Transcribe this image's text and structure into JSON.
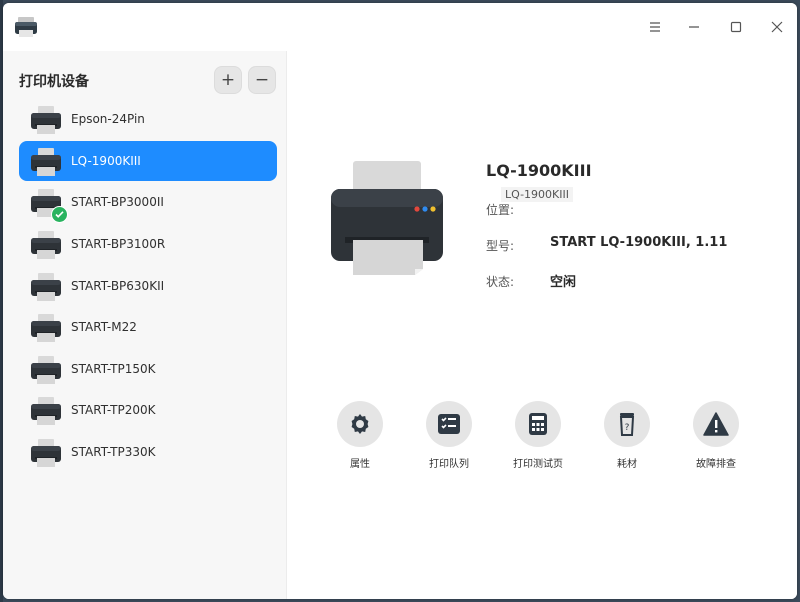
{
  "sidebar": {
    "title": "打印机设备",
    "add_label": "+",
    "remove_label": "−",
    "items": [
      {
        "label": "Epson-24Pin"
      },
      {
        "label": "LQ-1900KIII"
      },
      {
        "label": "START-BP3000II"
      },
      {
        "label": "START-BP3100R"
      },
      {
        "label": "START-BP630KII"
      },
      {
        "label": "START-M22"
      },
      {
        "label": "START-TP150K"
      },
      {
        "label": "START-TP200K"
      },
      {
        "label": "START-TP330K"
      }
    ],
    "selected_index": 1,
    "default_index": 2
  },
  "details": {
    "name": "LQ-1900KIII",
    "location_label": "位置:",
    "location_tooltip": "LQ-1900KIII",
    "model_label": "型号:",
    "model_value": "START LQ-1900KIII, 1.11",
    "status_label": "状态:",
    "status_value": "空闲"
  },
  "actions": [
    {
      "label": "属性",
      "icon": "gear-icon"
    },
    {
      "label": "打印队列",
      "icon": "queue-icon"
    },
    {
      "label": "打印测试页",
      "icon": "calculator-icon"
    },
    {
      "label": "耗材",
      "icon": "supplies-icon"
    },
    {
      "label": "故障排查",
      "icon": "warning-icon"
    }
  ],
  "colors": {
    "accent": "#1e8cff",
    "check": "#29b35f"
  }
}
